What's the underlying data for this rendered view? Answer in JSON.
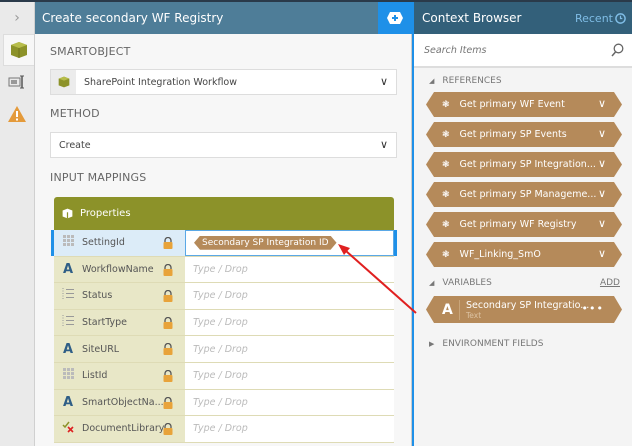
{
  "header": {
    "title": "Create secondary WF Registry"
  },
  "main": {
    "smartobject_label": "SMARTOBJECT",
    "smartobject_value": "SharePoint Integration Workflow",
    "method_label": "METHOD",
    "method_value": "Create",
    "input_mappings_label": "INPUT MAPPINGS",
    "grid_title": "Properties",
    "rows": [
      {
        "name": "SettingId",
        "type": "guid",
        "value": "Secondary SP Integration ID"
      },
      {
        "name": "WorkflowName",
        "type": "text",
        "placeholder": "Type / Drop"
      },
      {
        "name": "Status",
        "type": "list",
        "placeholder": "Type / Drop"
      },
      {
        "name": "StartType",
        "type": "list",
        "placeholder": "Type / Drop"
      },
      {
        "name": "SiteURL",
        "type": "text",
        "placeholder": "Type / Drop"
      },
      {
        "name": "ListId",
        "type": "guid",
        "placeholder": "Type / Drop"
      },
      {
        "name": "SmartObjectNa...",
        "type": "text",
        "placeholder": "Type / Drop"
      },
      {
        "name": "DocumentLibrary",
        "type": "yesno",
        "placeholder": "Type / Drop"
      }
    ]
  },
  "context": {
    "title": "Context Browser",
    "recent": "Recent",
    "search_placeholder": "Search Items",
    "references_label": "REFERENCES",
    "references": [
      "Get primary WF Event",
      "Get primary SP Events",
      "Get primary SP Integration...",
      "Get primary SP Manageme...",
      "Get primary WF Registry",
      "WF_Linking_SmO"
    ],
    "variables_label": "VARIABLES",
    "add_label": "ADD",
    "variable": {
      "name": "Secondary SP Integratio...",
      "type": "Text"
    },
    "environment_label": "ENVIRONMENT FIELDS"
  },
  "colors": {
    "header": "#4e7d98",
    "accent": "#1e90e8",
    "olive": "#8c9229",
    "reference": "#b58a5a",
    "arrow": "#e02020"
  }
}
